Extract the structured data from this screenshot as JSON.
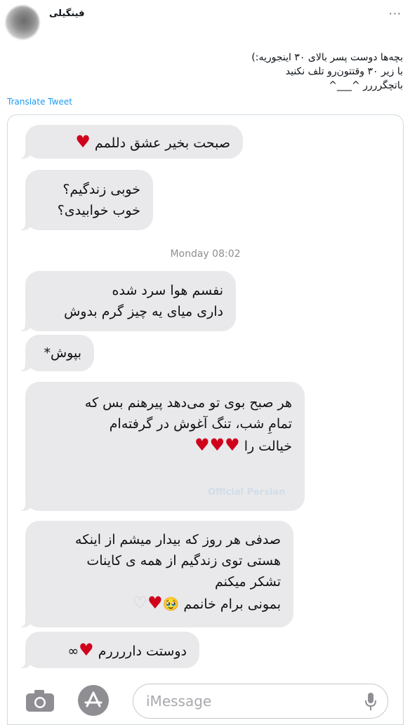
{
  "tweet": {
    "author_name": "فینگیلی",
    "more_label": "···",
    "text_lines": [
      "بچه‌ها دوست پسر بالای ۳۰ اینجوریه:)",
      "با زیر ۳۰ وقتتون‌رو تلف نکنید",
      "باتچگرررر ^___^"
    ],
    "translate_label": "Translate Tweet"
  },
  "conversation": {
    "timestamp": "Monday 08:02",
    "messages": [
      {
        "lines": [
          "صبحت بخیر عشق دللمم ♥"
        ]
      },
      {
        "lines": [
          "خوبی زندگیم؟",
          "خوب خوابیدی؟"
        ]
      },
      {
        "lines": [
          "نفسم هوا سرد شده",
          "داری میای یه چیز گرم بدوش"
        ]
      },
      {
        "lines": [
          "بپوش*"
        ]
      },
      {
        "lines": [
          "هر صبح بوی تو می‌دهد پیرهنم بس که",
          "تمامِ شب، تنگ آغوش در گرفته‌ام",
          "خیالت را ♥♥♥"
        ]
      },
      {
        "lines": [
          "صدفی هر روز که بیدار میشم از اینکه",
          "هستی توی زندگیم از همه ی کاینات",
          "تشکر میکنم",
          "بمونی برام خانمم 🥹♥♡"
        ]
      },
      {
        "lines": [
          "دوستت داررررم ♥∞"
        ]
      }
    ],
    "watermark": "Official Persian"
  },
  "composer": {
    "placeholder": "iMessage",
    "camera_icon": "camera-icon",
    "apps_icon": "app-store-icon",
    "mic_icon": "microphone-icon"
  },
  "colors": {
    "bubble": "#e9e9eb",
    "link": "#1d9bf0",
    "heart": "#d0021b"
  }
}
